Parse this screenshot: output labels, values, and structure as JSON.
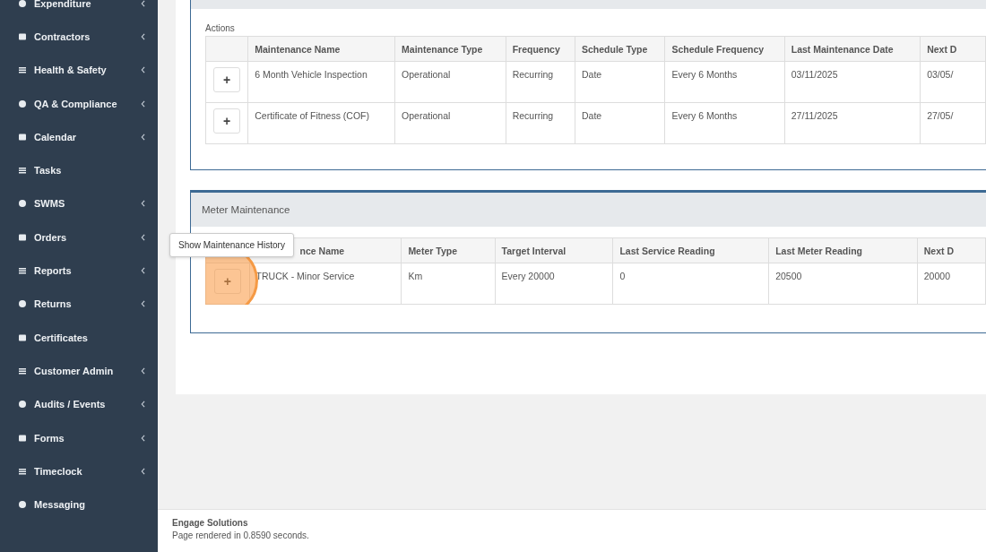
{
  "sidebar": {
    "items": [
      {
        "label": "Expenditure",
        "expandable": true
      },
      {
        "label": "Contractors",
        "expandable": true
      },
      {
        "label": "Health & Safety",
        "expandable": true
      },
      {
        "label": "QA & Compliance",
        "expandable": true
      },
      {
        "label": "Calendar",
        "expandable": true
      },
      {
        "label": "Tasks",
        "expandable": false
      },
      {
        "label": "SWMS",
        "expandable": true
      },
      {
        "label": "Orders",
        "expandable": true
      },
      {
        "label": "Reports",
        "expandable": true
      },
      {
        "label": "Returns",
        "expandable": true
      },
      {
        "label": "Certificates",
        "expandable": false
      },
      {
        "label": "Customer Admin",
        "expandable": true
      },
      {
        "label": "Audits / Events",
        "expandable": true
      },
      {
        "label": "Forms",
        "expandable": true
      },
      {
        "label": "Timeclock",
        "expandable": true
      },
      {
        "label": "Messaging",
        "expandable": false
      }
    ]
  },
  "schedule_table": {
    "caption": "Actions",
    "columns": [
      "",
      "Maintenance Name",
      "Maintenance Type",
      "Frequency",
      "Schedule Type",
      "Schedule Frequency",
      "Last Maintenance Date",
      "Next D"
    ],
    "rows": [
      {
        "cells": [
          "+",
          "6 Month Vehicle Inspection",
          "Operational",
          "Recurring",
          "Date",
          "Every 6 Months",
          "03/11/2025",
          "03/05/"
        ]
      },
      {
        "cells": [
          "+",
          "Certificate of Fitness (COF)",
          "Operational",
          "Recurring",
          "Date",
          "Every 6 Months",
          "27/11/2025",
          "27/05/"
        ]
      }
    ]
  },
  "meter_maintenance": {
    "title": "Meter Maintenance",
    "columns": [
      "",
      "nce Name",
      "Meter Type",
      "Target Interval",
      "Last Service Reading",
      "Last Meter Reading",
      "Next D"
    ],
    "rows": [
      {
        "highlighted": true,
        "cells": [
          "+",
          "TRUCK - Minor Service",
          "Km",
          "Every 20000",
          "0",
          "20500",
          "20000"
        ]
      }
    ],
    "tooltip": "Show Maintenance History"
  },
  "footer": {
    "company": "Engage Solutions",
    "render_time": "Page rendered in 0.8590 seconds."
  }
}
